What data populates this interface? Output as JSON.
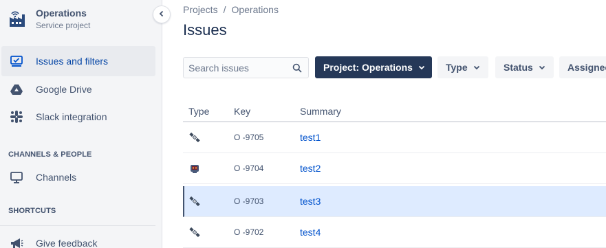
{
  "project": {
    "name": "Operations",
    "type": "Service project"
  },
  "sidebar": {
    "items": [
      {
        "label": "Issues and filters",
        "icon": "issues-filter-icon",
        "active": true
      },
      {
        "label": "Google Drive",
        "icon": "google-drive-icon",
        "active": false
      },
      {
        "label": "Slack integration",
        "icon": "slack-icon",
        "active": false
      }
    ],
    "channels_title": "CHANNELS & PEOPLE",
    "channels_item": "Channels",
    "shortcuts_title": "SHORTCUTS",
    "feedback_item": "Give feedback"
  },
  "breadcrumb": {
    "root": "Projects",
    "separator": "/",
    "current": "Operations"
  },
  "page": {
    "title": "Issues"
  },
  "search": {
    "placeholder": "Search issues"
  },
  "filters": {
    "project": "Project: Operations",
    "type": "Type",
    "status": "Status",
    "assignee": "Assignee"
  },
  "table": {
    "headers": {
      "type": "Type",
      "key": "Key",
      "summary": "Summary"
    },
    "rows": [
      {
        "type_icon": "satellite-icon",
        "key": "O -9705",
        "summary": "test1"
      },
      {
        "type_icon": "robot-icon",
        "key": "O -9704",
        "summary": "test2"
      },
      {
        "type_icon": "satellite-icon",
        "key": "O -9703",
        "summary": "test3"
      },
      {
        "type_icon": "satellite-icon",
        "key": "O -9702",
        "summary": "test4"
      }
    ]
  },
  "colors": {
    "accent": "#0052cc",
    "primary_button": "#253858",
    "selected_row": "#deebff",
    "sidebar_bg": "#f4f5f7"
  }
}
